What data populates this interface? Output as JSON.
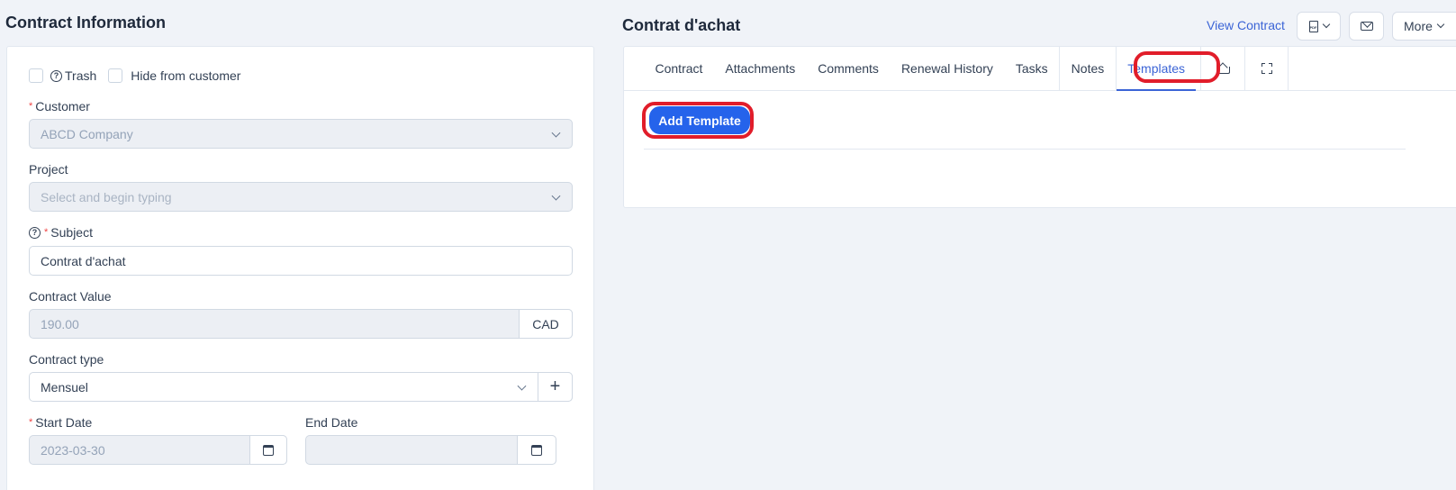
{
  "left": {
    "title": "Contract Information",
    "checkboxes": [
      {
        "label": "Trash",
        "checked": false,
        "has_help": true
      },
      {
        "label": "Hide from customer",
        "checked": false,
        "has_help": false
      }
    ],
    "customer": {
      "label": "Customer",
      "required": true,
      "value": "ABCD Company"
    },
    "project": {
      "label": "Project",
      "required": false,
      "placeholder": "Select and begin typing"
    },
    "subject": {
      "label": "Subject",
      "required": true,
      "value": "Contrat d'achat"
    },
    "contract_value": {
      "label": "Contract Value",
      "value": "190.00",
      "currency": "CAD"
    },
    "contract_type": {
      "label": "Contract type",
      "value": "Mensuel",
      "add_label": "+"
    },
    "start_date": {
      "label": "Start Date",
      "required": true,
      "value": "2023-03-30"
    },
    "end_date": {
      "label": "End Date",
      "value": ""
    }
  },
  "right": {
    "title": "Contrat d'achat",
    "view_contract": "View Contract",
    "more_label": "More",
    "pdf_glyph": "PDF",
    "tabs": [
      {
        "label": "Contract"
      },
      {
        "label": "Attachments"
      },
      {
        "label": "Comments"
      },
      {
        "label": "Renewal History"
      },
      {
        "label": "Tasks"
      },
      {
        "label": "Notes"
      },
      {
        "label": "Templates",
        "active": true
      }
    ],
    "add_template": "Add Template"
  },
  "colors": {
    "accent": "#2563eb",
    "link": "#3b64d6",
    "highlight": "#e11d2a",
    "required": "#ef4444"
  }
}
